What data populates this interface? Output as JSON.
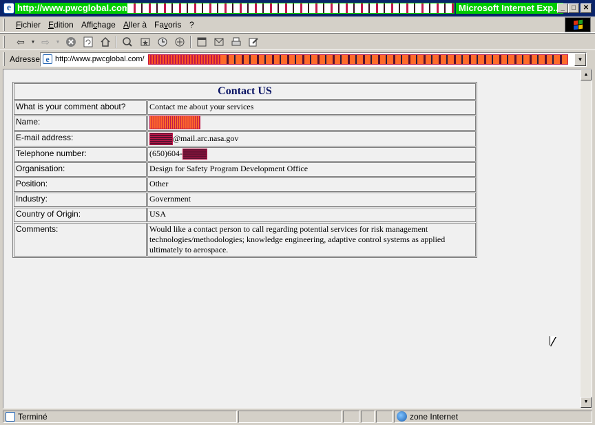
{
  "window": {
    "title_url": "http://www.pwcglobal.com/",
    "app_name": "Microsoft Internet Exp...",
    "minimize": "_",
    "maximize": "□",
    "close": "✕"
  },
  "menu": {
    "items": [
      "Fichier",
      "Edition",
      "Affichage",
      "Aller à",
      "Favoris",
      "?"
    ]
  },
  "toolbar": {
    "icons": [
      "back-icon",
      "forward-icon",
      "stop-icon",
      "refresh-icon",
      "home-icon",
      "search-icon",
      "favorites-icon",
      "history-icon",
      "channels-icon",
      "fullscreen-icon",
      "mail-icon",
      "print-icon",
      "edit-icon"
    ]
  },
  "address": {
    "label": "Adresse",
    "url": "http://www.pwcglobal.com/"
  },
  "form": {
    "title": "Contact US",
    "rows": [
      {
        "label": "What is your comment about?",
        "value": "Contact me about your services"
      },
      {
        "label": "Name:",
        "value": ""
      },
      {
        "label": "E-mail address:",
        "value": "@mail.arc.nasa.gov"
      },
      {
        "label": "Telephone number:",
        "value": "(650)604-"
      },
      {
        "label": "Organisation:",
        "value": "Design for Safety Program Development Office"
      },
      {
        "label": "Position:",
        "value": "Other"
      },
      {
        "label": "Industry:",
        "value": "Government"
      },
      {
        "label": "Country of Origin:",
        "value": "USA"
      },
      {
        "label": "Comments:",
        "value": "Would like a contact person to call regarding potential services for risk management technologies/methodologies; knowledge engineering, adaptive control systems as applied ultimately to aerospace."
      }
    ]
  },
  "status": {
    "text": "Terminé",
    "zone": "zone Internet"
  }
}
